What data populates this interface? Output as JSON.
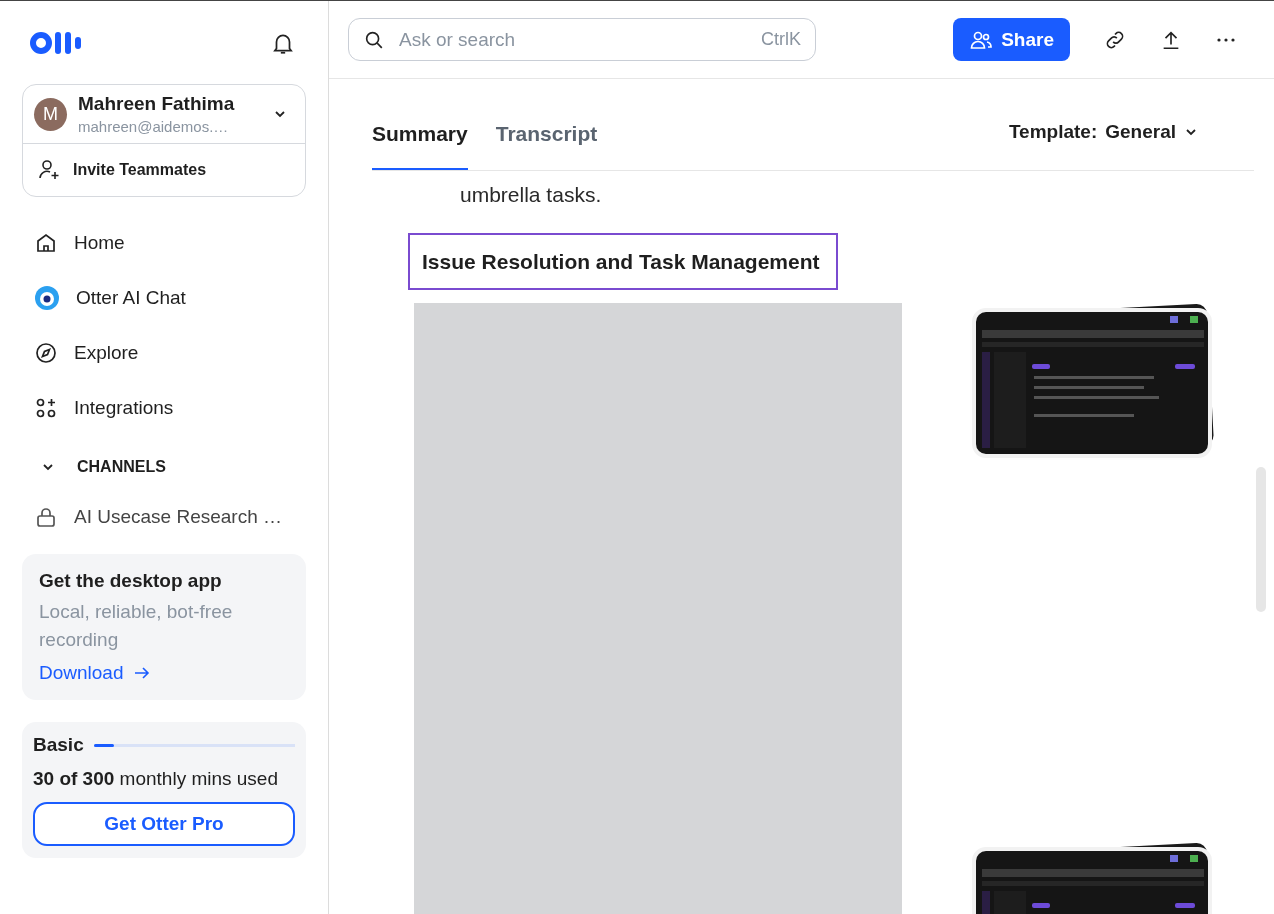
{
  "account": {
    "initial": "M",
    "name": "Mahreen Fathima",
    "email": "mahreen@aidemos.…",
    "invite": "Invite Teammates"
  },
  "nav": [
    {
      "kind": "home",
      "label": "Home"
    },
    {
      "kind": "chat",
      "label": "Otter AI Chat"
    },
    {
      "kind": "explore",
      "label": "Explore"
    },
    {
      "kind": "integrations",
      "label": "Integrations"
    }
  ],
  "channels": {
    "heading": "CHANNELS",
    "expanded": true,
    "items": [
      {
        "label": "AI Usecase Research …",
        "locked": true
      }
    ]
  },
  "desktop_promo": {
    "title": "Get the desktop app",
    "text": "Local, reliable, bot-free recording",
    "link": "Download"
  },
  "plan": {
    "name": "Basic",
    "level": 0.1,
    "usage": "**30 of 300** monthly mins used",
    "button": "Get Otter Pro"
  },
  "search": {
    "placeholder": "Ask or search",
    "shortcut": "CtrlK"
  },
  "share": "Share",
  "tabs": [
    {
      "label": "Summary",
      "selected": true
    },
    {
      "label": "Transcript",
      "selected": false
    }
  ],
  "template": {
    "label": "Template:",
    "value": "General"
  },
  "summary": {
    "text": "umbrella tasks.",
    "heading": "Issue Resolution and Task Management"
  }
}
